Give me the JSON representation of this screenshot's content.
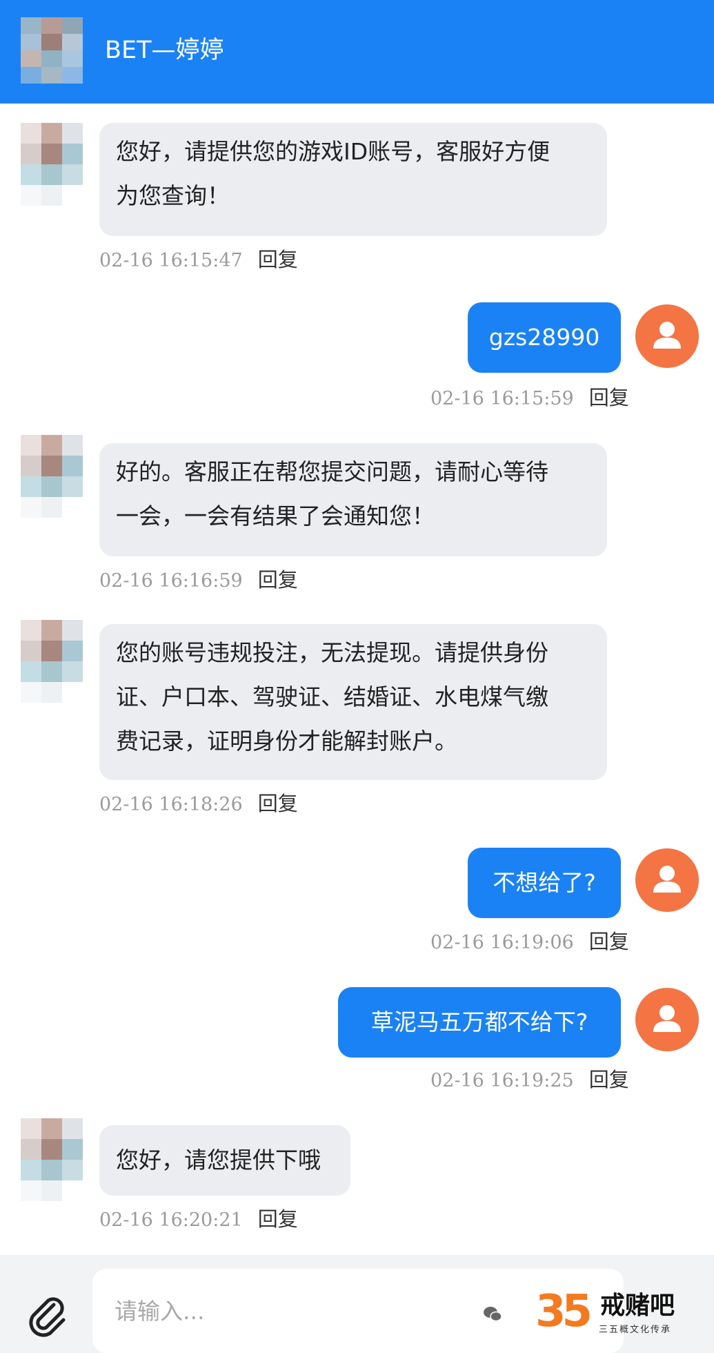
{
  "header": {
    "title": "BET—婷婷"
  },
  "messages": [
    {
      "side": "left",
      "lines": [
        "您好，请提供您的游戏ID账号，客服好方便",
        "为您查询！"
      ],
      "time": "02-16 16:15:47",
      "reply": "回复"
    },
    {
      "side": "right",
      "text": "gzs28990",
      "time": "02-16 16:15:59",
      "reply": "回复"
    },
    {
      "side": "left",
      "lines": [
        "好的。客服正在帮您提交问题，请耐心等待",
        "一会，一会有结果了会通知您！"
      ],
      "time": "02-16 16:16:59",
      "reply": "回复"
    },
    {
      "side": "left",
      "lines": [
        "您的账号违规投注，无法提现。请提供身份",
        "证、户口本、驾驶证、结婚证、水电煤气缴",
        "费记录，证明身份才能解封账户。"
      ],
      "time": "02-16 16:18:26",
      "reply": "回复"
    },
    {
      "side": "right",
      "text": "不想给了?",
      "time": "02-16 16:19:06",
      "reply": "回复"
    },
    {
      "side": "right",
      "text": "草泥马五万都不给下?",
      "time": "02-16 16:19:25",
      "reply": "回复"
    },
    {
      "side": "left",
      "lines": [
        "您好，请您提供下哦"
      ],
      "time": "02-16 16:20:21",
      "reply": "回复"
    }
  ],
  "composer": {
    "placeholder": "请输入..."
  },
  "watermark": {
    "number": "35",
    "name": "戒赌吧",
    "subtitle": "三五概文化传承"
  },
  "colors": {
    "accent": "#1a82f4",
    "user_avatar": "#f47444",
    "bubble_left": "#ebedf1"
  },
  "icons": {
    "attach": "paperclip-icon",
    "user_avatar": "user-icon",
    "watermark": "wechat-icon"
  }
}
